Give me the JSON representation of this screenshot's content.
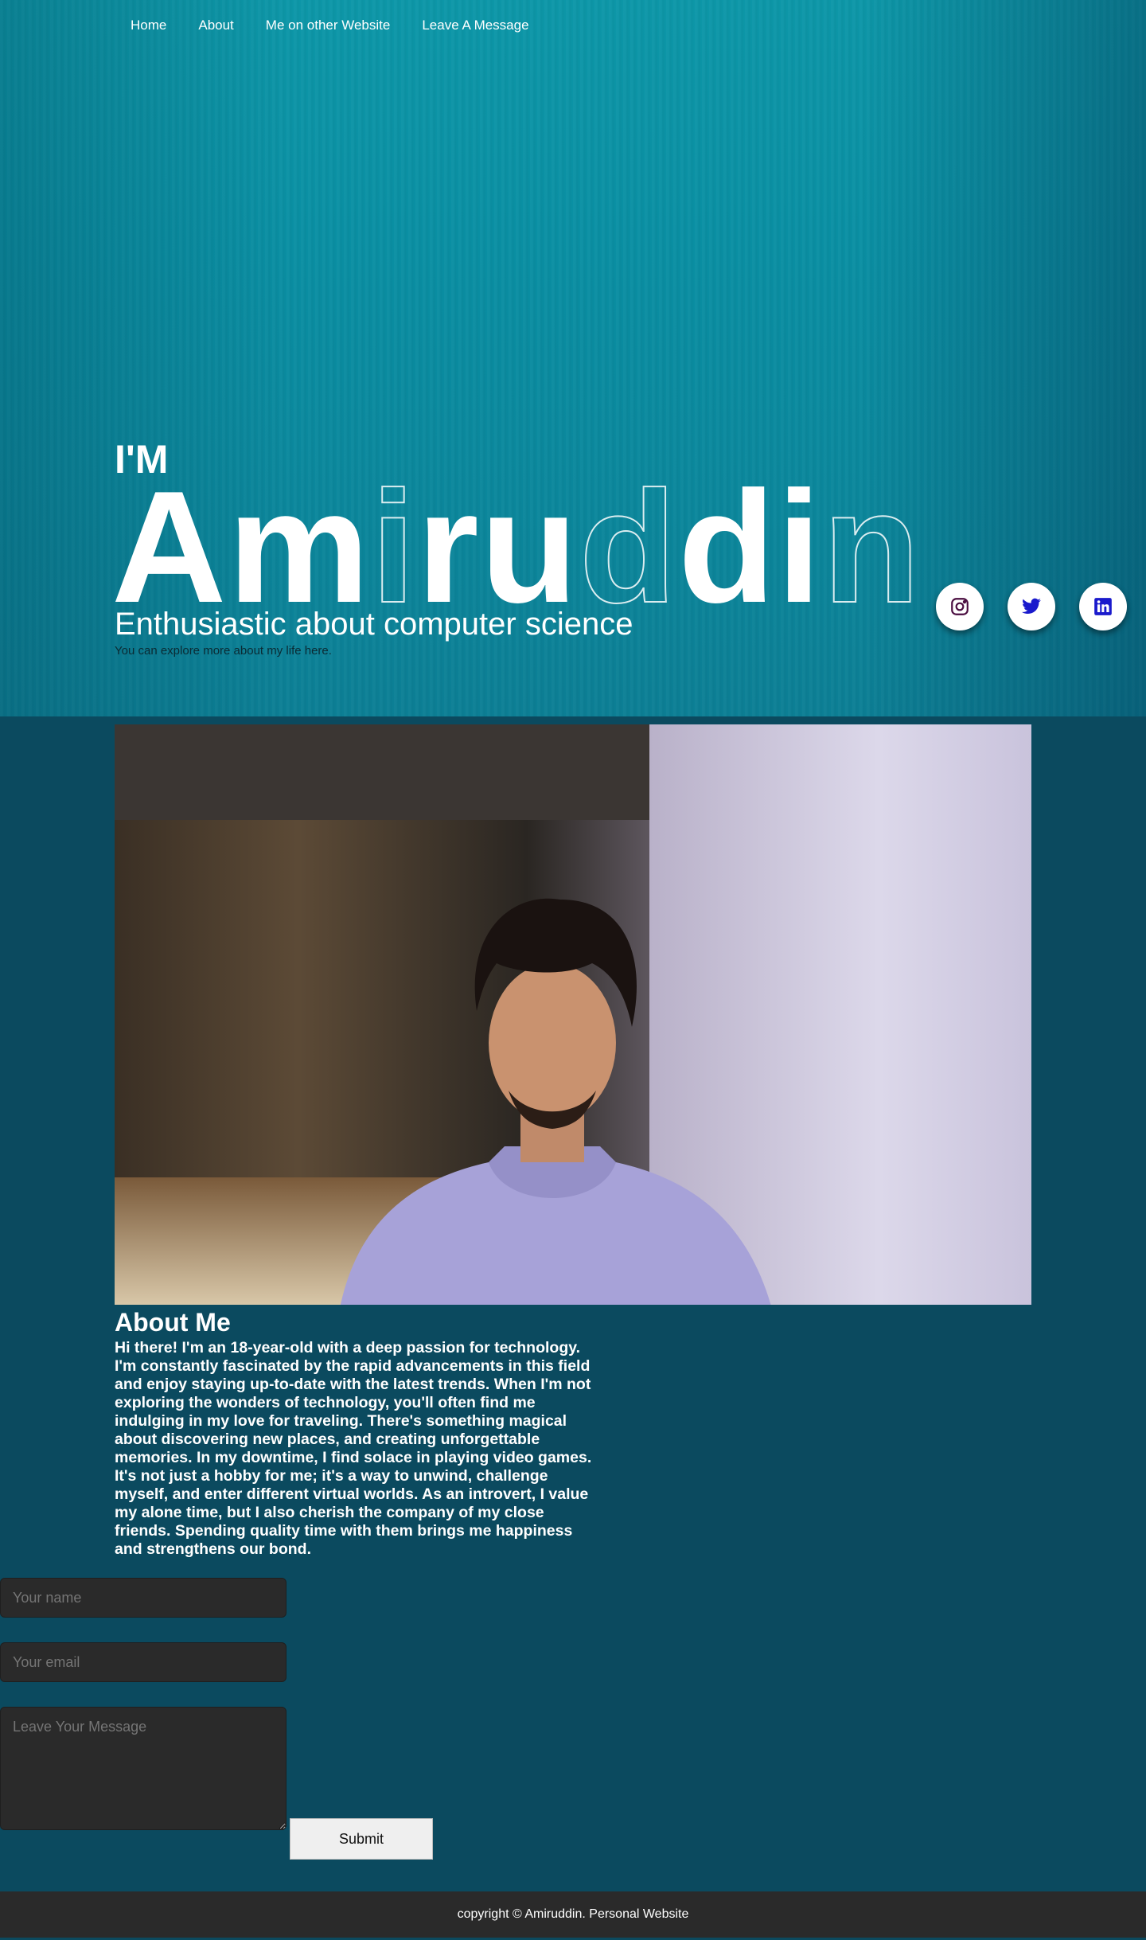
{
  "nav": {
    "items": [
      "Home",
      "About",
      "Me on other Website",
      "Leave A Message"
    ]
  },
  "hero": {
    "prefix": "I'M",
    "name_parts": [
      {
        "text": "Am",
        "style": "solid"
      },
      {
        "text": "i",
        "style": "outline"
      },
      {
        "text": "ru",
        "style": "solid"
      },
      {
        "text": "d",
        "style": "outline"
      },
      {
        "text": "di",
        "style": "solid"
      },
      {
        "text": "n",
        "style": "outline"
      }
    ],
    "subtitle": "Enthusiastic about computer science",
    "tagline": "You can explore more about my life here.",
    "colors": {
      "background": "#0a8fa3"
    }
  },
  "socials": [
    {
      "icon": "instagram-icon",
      "color": "#4a0d40"
    },
    {
      "icon": "twitter-icon",
      "color": "#1a1acc"
    },
    {
      "icon": "linkedin-icon",
      "color": "#1a1acc"
    }
  ],
  "about": {
    "title": "About Me",
    "text": "Hi there! I'm an 18-year-old with a deep passion for technology. I'm constantly fascinated by the rapid advancements in this field and enjoy staying up-to-date with the latest trends. When I'm not exploring the wonders of technology, you'll often find me indulging in my love for traveling. There's something magical about discovering new places, and creating unforgettable memories. In my downtime, I find solace in playing video games. It's not just a hobby for me; it's a way to unwind, challenge myself, and enter different virtual worlds. As an introvert, I value my alone time, but I also cherish the company of my close friends. Spending quality time with them brings me happiness and strengthens our bond."
  },
  "form": {
    "name_placeholder": "Your name",
    "email_placeholder": "Your email",
    "message_placeholder": "Leave Your Message",
    "submit_label": "Submit"
  },
  "footer": {
    "text": "copyright © Amiruddin. Personal Website"
  }
}
